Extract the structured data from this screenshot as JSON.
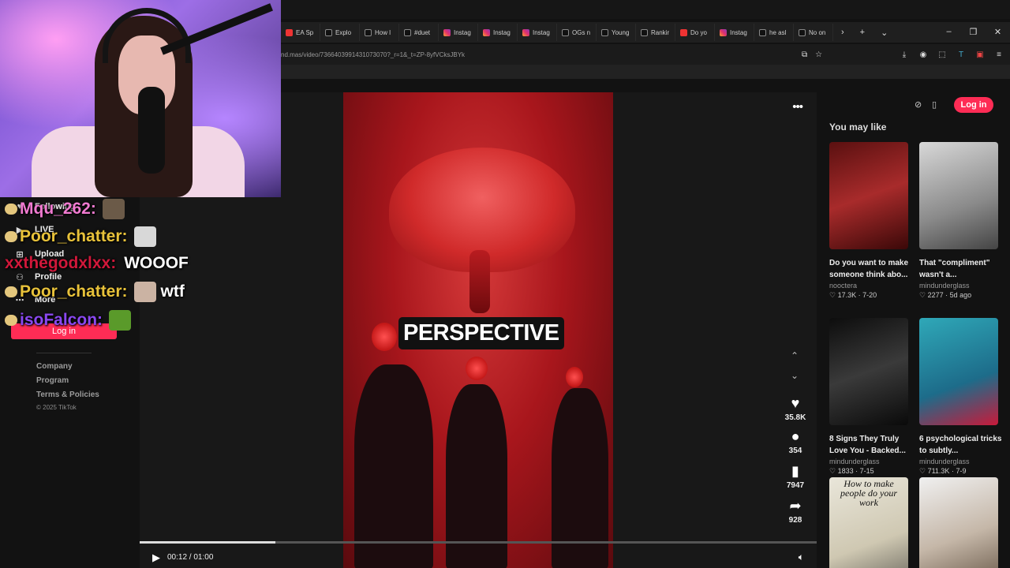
{
  "browser": {
    "tabs": [
      {
        "label": "EA Sp",
        "icon": "youtube-icon"
      },
      {
        "label": "Explo",
        "icon": "tiktok-icon"
      },
      {
        "label": "How l",
        "icon": "tiktok-icon"
      },
      {
        "label": "#duet",
        "icon": "tiktok-icon"
      },
      {
        "label": "Instag",
        "icon": "instagram-icon"
      },
      {
        "label": "Instag",
        "icon": "instagram-icon"
      },
      {
        "label": "Instag",
        "icon": "instagram-icon"
      },
      {
        "label": "OGs n",
        "icon": "tiktok-icon"
      },
      {
        "label": "Young",
        "icon": "tiktok-icon"
      },
      {
        "label": "Rankir",
        "icon": "tiktok-icon"
      },
      {
        "label": "Do yo",
        "icon": "youtube-icon"
      },
      {
        "label": "Instag",
        "icon": "instagram-icon"
      },
      {
        "label": "he asl",
        "icon": "tiktok-icon"
      },
      {
        "label": "No on",
        "icon": "tiktok-icon"
      }
    ],
    "url": "nd.mas/video/7366403991431073070?_r=1&_t=ZP-8yfVCksJBYk"
  },
  "sidebar": {
    "nav": [
      {
        "label": "Following",
        "icon": "following-icon"
      },
      {
        "label": "LIVE",
        "icon": "live-icon"
      },
      {
        "label": "Upload",
        "icon": "upload-icon"
      },
      {
        "label": "Profile",
        "icon": "profile-icon"
      },
      {
        "label": "More",
        "icon": "more-icon"
      }
    ],
    "login_label": "Log in",
    "footer": [
      "Company",
      "Program",
      "Terms & Policies"
    ],
    "copyright": "© 2025 TikTok"
  },
  "video": {
    "caption": "PERSPECTIVE",
    "likes": "35.8K",
    "comments": "354",
    "saves": "7947",
    "shares": "928",
    "time": "00:12 / 01:00",
    "progress": 0.2
  },
  "header": {
    "login_label": "Log in"
  },
  "recommendations": {
    "heading": "You may like",
    "cards": [
      {
        "title": "Do you want to make someone think abo...",
        "author": "nooctera",
        "likes": "17.3K",
        "date": "7-20",
        "thumb_text": ""
      },
      {
        "title": "That \"compliment\" wasn't a...",
        "author": "mindunderglass",
        "likes": "2277",
        "date": "5d ago",
        "thumb_text": ""
      },
      {
        "title": "8 Signs They Truly Love You - Backed...",
        "author": "mindunderglass",
        "likes": "1833",
        "date": "7-15",
        "thumb_text": ""
      },
      {
        "title": "6 psychological tricks to subtly...",
        "author": "mindunderglass",
        "likes": "711.3K",
        "date": "7-9",
        "thumb_text": ""
      },
      {
        "title": "",
        "author": "",
        "likes": "",
        "date": "",
        "thumb_text": "How to make people do your work"
      },
      {
        "title": "",
        "author": "",
        "likes": "",
        "date": "",
        "thumb_text": ""
      }
    ]
  },
  "chat": [
    {
      "user": "Mqu_262:",
      "message": "",
      "color": "#f07ad0"
    },
    {
      "user": "Poor_chatter:",
      "message": "",
      "color": "#e8c23a"
    },
    {
      "user": "xxthegodxlxx:",
      "message": "WOOOF",
      "color": "#d0183a"
    },
    {
      "user": "Poor_chatter:",
      "message": "wtf",
      "color": "#e8c23a"
    },
    {
      "user": "isoFalcon:",
      "message": "",
      "color": "#8a48f0"
    }
  ]
}
